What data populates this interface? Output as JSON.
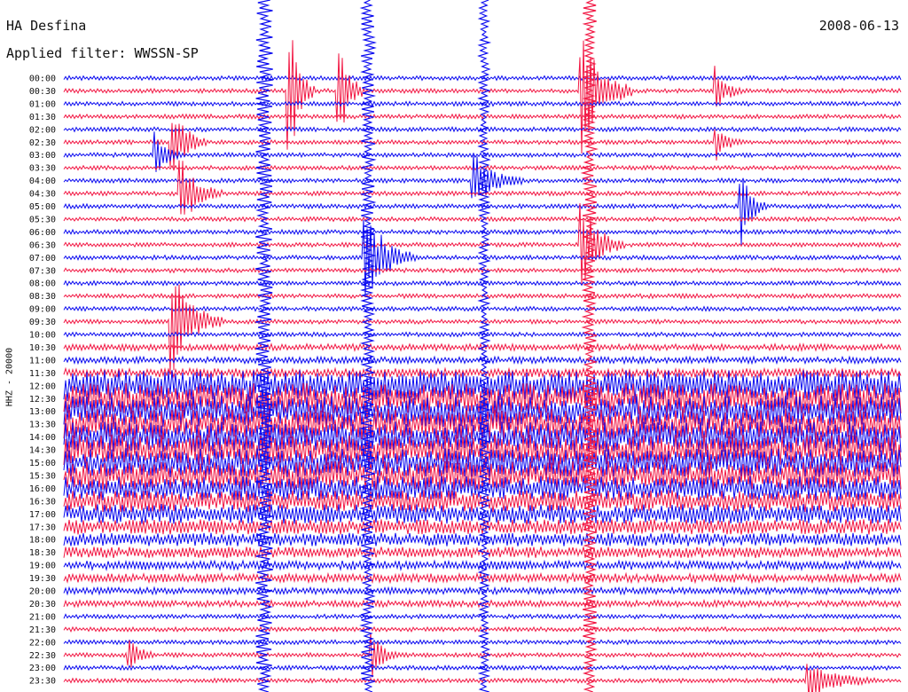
{
  "header": {
    "station": "HA Desfina",
    "filter": "Applied filter: WWSSN-SP",
    "date": "2008-06-13"
  },
  "colors": {
    "trace_a": "#0b0bf0",
    "trace_b": "#f21844",
    "background": "#ffffff",
    "text": "#111111"
  },
  "chart_data": {
    "type": "line",
    "title": "HA Desfina",
    "subtitle": "Applied filter: WWSSN-SP",
    "date": "2008-06-13",
    "ylabel": "HHZ - 20000",
    "xlabel": "",
    "y_tick_labels": [
      "00:00",
      "00:30",
      "01:00",
      "01:30",
      "02:00",
      "02:30",
      "03:00",
      "03:30",
      "04:00",
      "04:30",
      "05:00",
      "05:30",
      "06:00",
      "06:30",
      "07:00",
      "07:30",
      "08:00",
      "08:30",
      "09:00",
      "09:30",
      "10:00",
      "10:30",
      "11:00",
      "11:30",
      "12:00",
      "12:30",
      "13:00",
      "13:30",
      "14:00",
      "14:30",
      "15:00",
      "15:30",
      "16:00",
      "16:30",
      "17:00",
      "17:30",
      "18:00",
      "18:30",
      "19:00",
      "19:30",
      "20:00",
      "20:30",
      "21:00",
      "21:30",
      "22:00",
      "22:30",
      "23:00",
      "23:30"
    ],
    "trace_colors_alternating": [
      "blue",
      "red"
    ],
    "noise_levels": [
      2,
      2,
      2,
      2,
      2,
      2,
      2,
      2,
      2,
      2,
      2,
      2,
      2,
      2,
      2,
      2,
      2,
      2,
      2,
      2,
      2,
      3,
      3,
      4,
      14,
      14,
      14,
      14,
      14,
      14,
      13,
      13,
      11,
      10,
      9,
      7,
      6,
      5,
      4,
      4,
      3,
      3,
      2,
      2,
      2,
      2,
      2,
      2
    ],
    "events": [
      {
        "trace": "00:30",
        "position": 0.27,
        "amplitude": 90,
        "duration": 0.03
      },
      {
        "trace": "00:30",
        "position": 0.33,
        "amplitude": 60,
        "duration": 0.03
      },
      {
        "trace": "00:30",
        "position": 0.62,
        "amplitude": 70,
        "duration": 0.06
      },
      {
        "trace": "00:30",
        "position": 0.78,
        "amplitude": 30,
        "duration": 0.03
      },
      {
        "trace": "02:30",
        "position": 0.13,
        "amplitude": 45,
        "duration": 0.04
      },
      {
        "trace": "02:30",
        "position": 0.78,
        "amplitude": 20,
        "duration": 0.03
      },
      {
        "trace": "03:00",
        "position": 0.11,
        "amplitude": 25,
        "duration": 0.03
      },
      {
        "trace": "04:00",
        "position": 0.49,
        "amplitude": 30,
        "duration": 0.06
      },
      {
        "trace": "04:30",
        "position": 0.14,
        "amplitude": 40,
        "duration": 0.05
      },
      {
        "trace": "05:00",
        "position": 0.81,
        "amplitude": 45,
        "duration": 0.03
      },
      {
        "trace": "06:30",
        "position": 0.62,
        "amplitude": 50,
        "duration": 0.05
      },
      {
        "trace": "07:00",
        "position": 0.36,
        "amplitude": 60,
        "duration": 0.06
      },
      {
        "trace": "09:30",
        "position": 0.13,
        "amplitude": 60,
        "duration": 0.06
      },
      {
        "trace": "22:30",
        "position": 0.37,
        "amplitude": 25,
        "duration": 0.03
      },
      {
        "trace": "22:30",
        "position": 0.08,
        "amplitude": 20,
        "duration": 0.03
      },
      {
        "trace": "23:30",
        "position": 0.89,
        "amplitude": 25,
        "duration": 0.08
      }
    ]
  }
}
